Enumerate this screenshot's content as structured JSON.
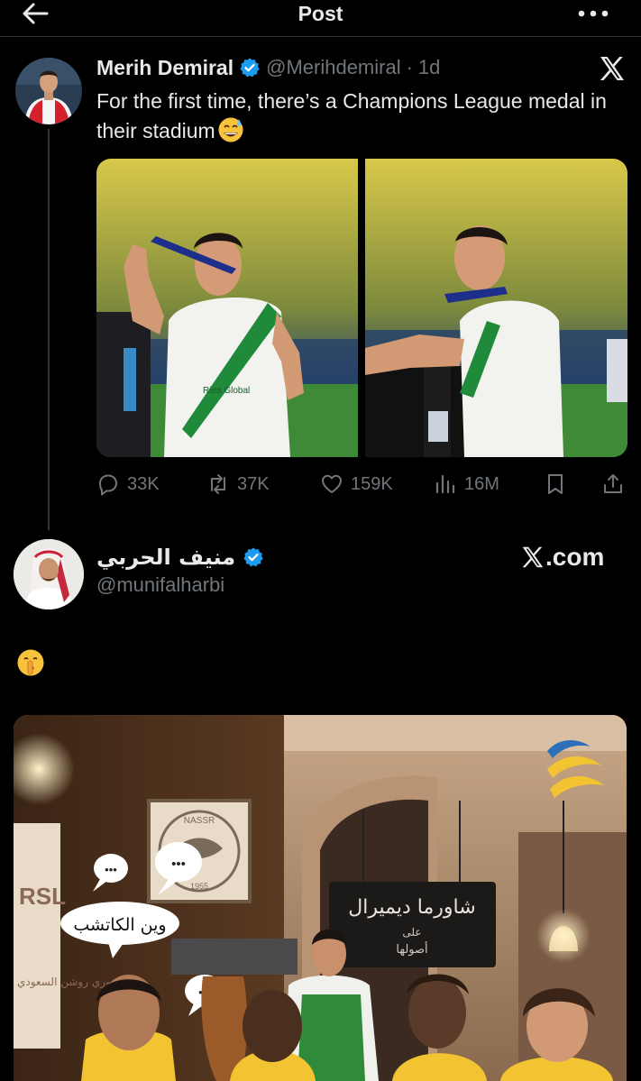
{
  "header": {
    "title": "Post"
  },
  "tweet1": {
    "display_name": "Merih Demiral",
    "handle": "@Merihdemiral",
    "separator": "·",
    "time": "1d",
    "text": "For the first time, there’s a Champions League medal in their stadium",
    "emoji": "sweat-smile",
    "stats": {
      "replies": "33K",
      "reposts": "37K",
      "likes": "159K",
      "views": "16M"
    }
  },
  "tweet2": {
    "display_name": "منيف الحربي",
    "handle": "@munifalharbi",
    "source_label": ".com",
    "emoji": "shushing-face",
    "poster": {
      "shop_sign": "شاورما ديميرال",
      "shop_sub1": "على",
      "shop_sub2": "أصولها",
      "bubble_text": "وين الكاتشب",
      "bubble_dots": "•••",
      "league_text": "دوري روشن السعودي",
      "club_text": "NASSR",
      "club_year": "1955"
    }
  },
  "colors": {
    "background": "#000000",
    "text": "#e7e9ea",
    "muted": "#71767b",
    "verified": "#1d9bf0",
    "divider": "#2f3336"
  }
}
